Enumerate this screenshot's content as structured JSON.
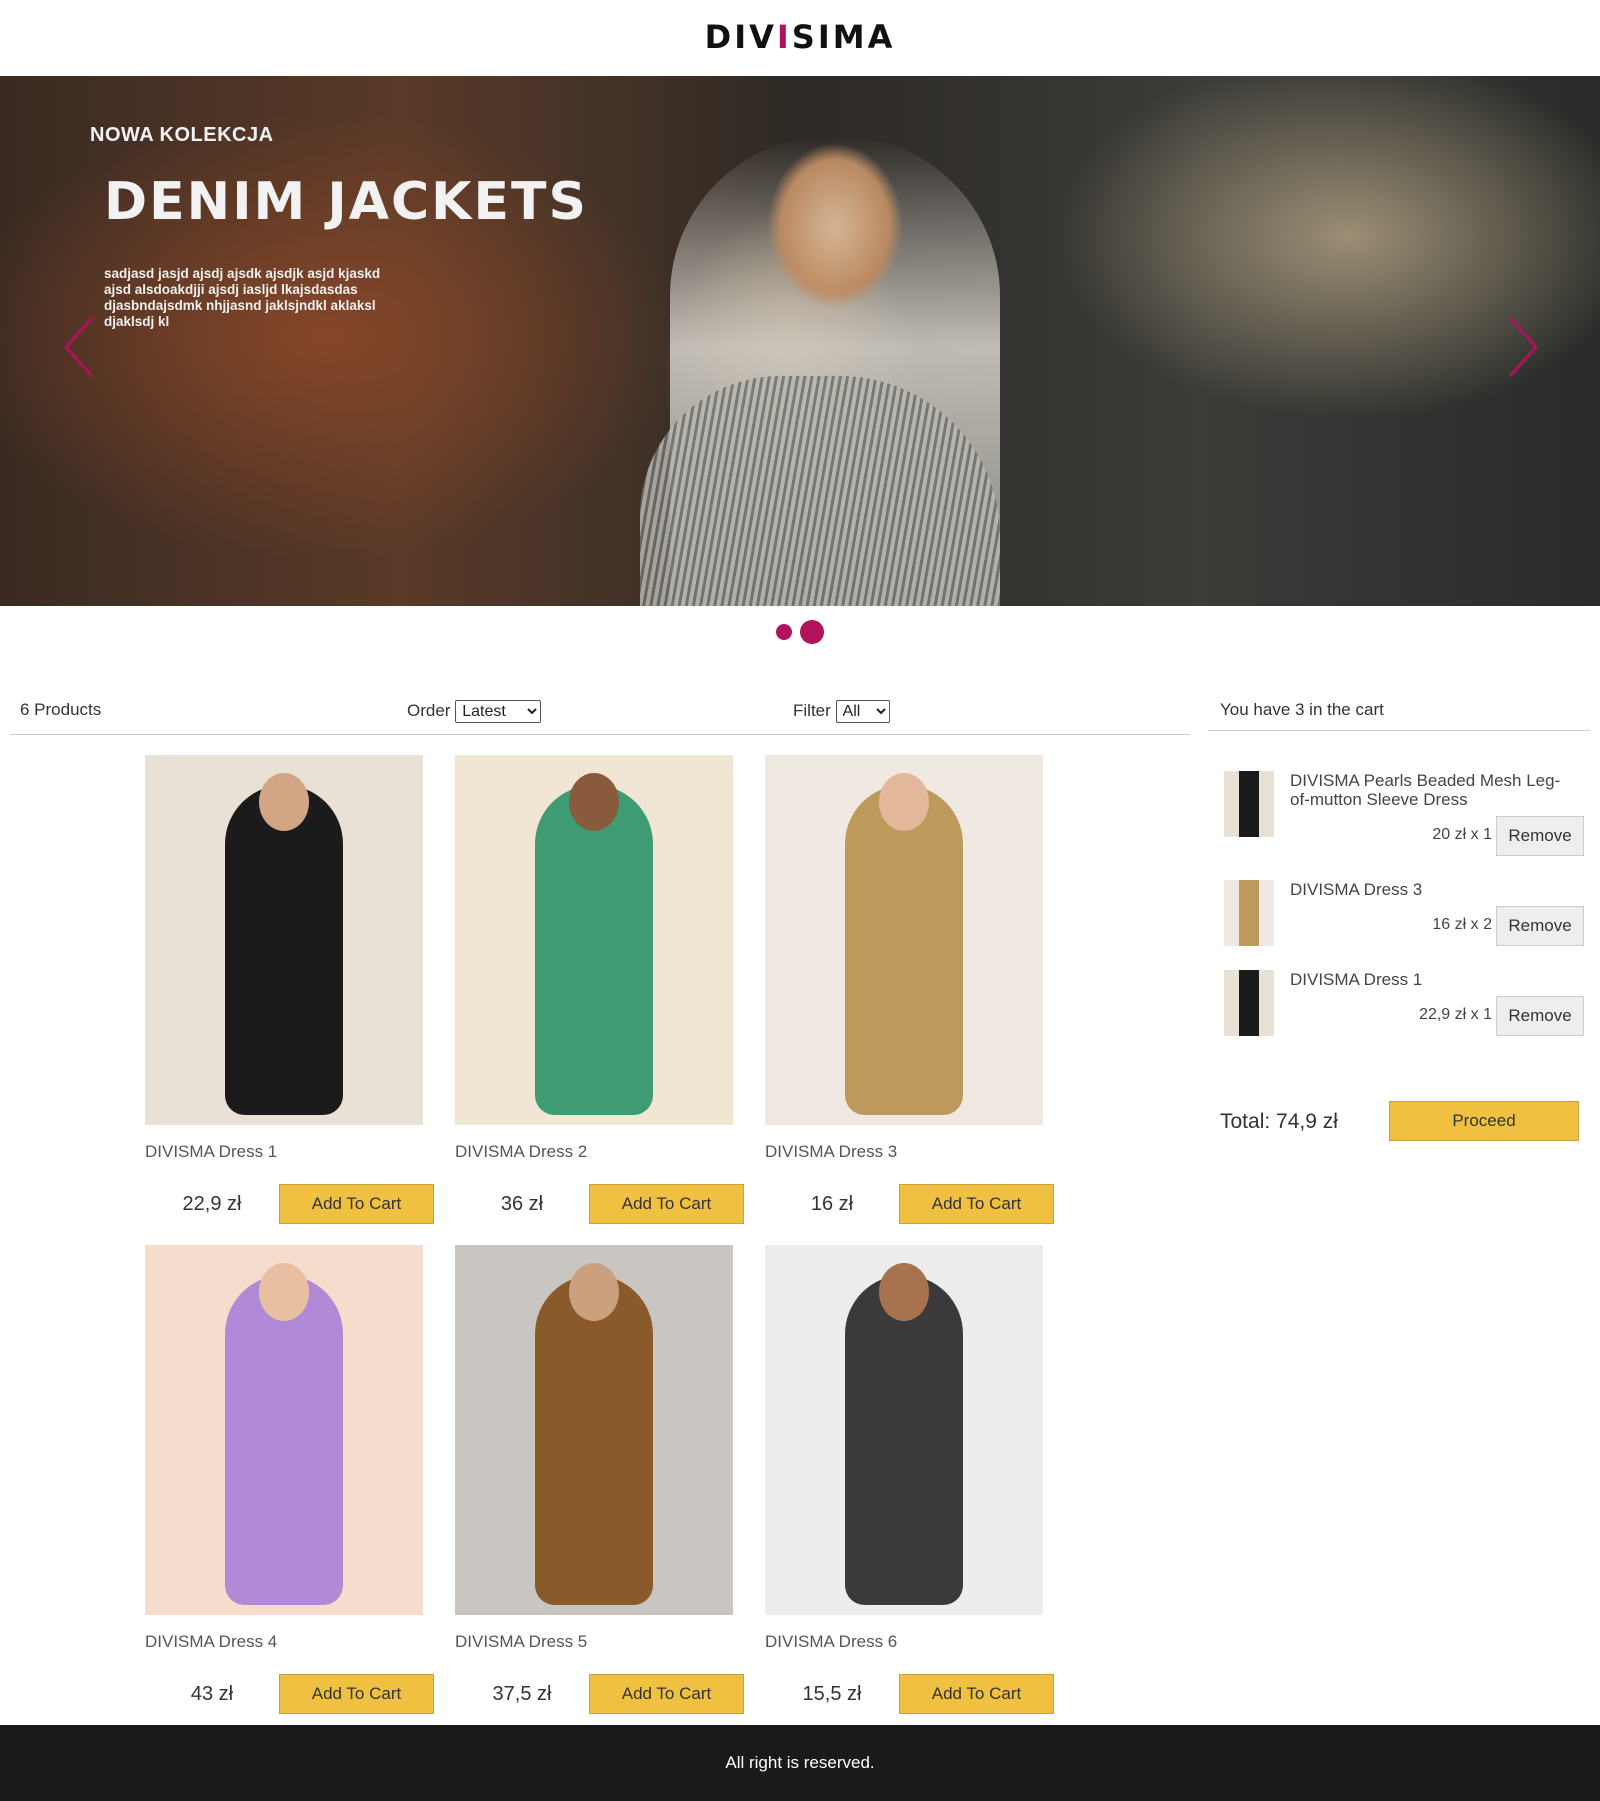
{
  "brand": {
    "logo_text_left": "DIV",
    "logo_text_accent": "I",
    "logo_text_right": "SIMA",
    "accent_color": "#b0125e"
  },
  "hero": {
    "subtitle": "NOWA KOLEKCJA",
    "title": "DENIM JACKETS",
    "text": "sadjasd jasjd ajsdj ajsdk ajsdjk asjd kjaskd ajsd alsdoakdjji ajsdj iasljd lkajsdasdas djasbndajsdmk nhjjasnd jaklsjndkl aklaksl djaklsdj kl",
    "prev_icon": "chevron-left-icon",
    "next_icon": "chevron-right-icon",
    "slides": 2,
    "active_slide": 2
  },
  "toolbar": {
    "count_label": "6 Products",
    "order_label": "Order",
    "order_value": "Latest",
    "filter_label": "Filter",
    "filter_value": "All"
  },
  "products": [
    {
      "name": "DIVISMA Dress 1",
      "price": "22,9 zł",
      "button": "Add To Cart",
      "dress_color": "#1b1b1b",
      "bg_color": "#e9e1d6",
      "skin_color": "#d2a585"
    },
    {
      "name": "DIVISMA Dress 2",
      "price": "36 zł",
      "button": "Add To Cart",
      "dress_color": "#3f9b74",
      "bg_color": "#f1e6d3",
      "skin_color": "#8a5a3c"
    },
    {
      "name": "DIVISMA Dress 3",
      "price": "16 zł",
      "button": "Add To Cart",
      "dress_color": "#bd9a5c",
      "bg_color": "#efe9e1",
      "skin_color": "#e3b89a"
    },
    {
      "name": "DIVISMA Dress 4",
      "price": "43 zł",
      "button": "Add To Cart",
      "dress_color": "#b08ad6",
      "bg_color": "#f5dccd",
      "skin_color": "#e8bfa0"
    },
    {
      "name": "DIVISMA Dress 5",
      "price": "37,5 zł",
      "button": "Add To Cart",
      "dress_color": "#8a5a2b",
      "bg_color": "#c9c6c1",
      "skin_color": "#caa07e"
    },
    {
      "name": "DIVISMA Dress 6",
      "price": "15,5 zł",
      "button": "Add To Cart",
      "dress_color": "#3a3a3a",
      "bg_color": "#ededed",
      "skin_color": "#a8714f"
    }
  ],
  "cart": {
    "header": "You have 3 in the cart",
    "items": [
      {
        "title": "DIVISMA Pearls Beaded Mesh Leg-of-mutton Sleeve Dress",
        "qty": "20 zł x 1",
        "button": "Remove",
        "dress_color": "#1b1b1b",
        "bg_color": "#e9e1d6"
      },
      {
        "title": "DIVISMA Dress 3",
        "qty": "16 zł x 2",
        "button": "Remove",
        "dress_color": "#bd9a5c",
        "bg_color": "#efe9e1"
      },
      {
        "title": "DIVISMA Dress 1",
        "qty": "22,9 zł x 1",
        "button": "Remove",
        "dress_color": "#1b1b1b",
        "bg_color": "#e9e1d6"
      }
    ],
    "total": "Total: 74,9 zł",
    "proceed": "Proceed"
  },
  "footer": {
    "text": "All right is reserved."
  },
  "colors": {
    "button_yellow": "#f0c040",
    "footer_bg": "#1a1a1a"
  }
}
